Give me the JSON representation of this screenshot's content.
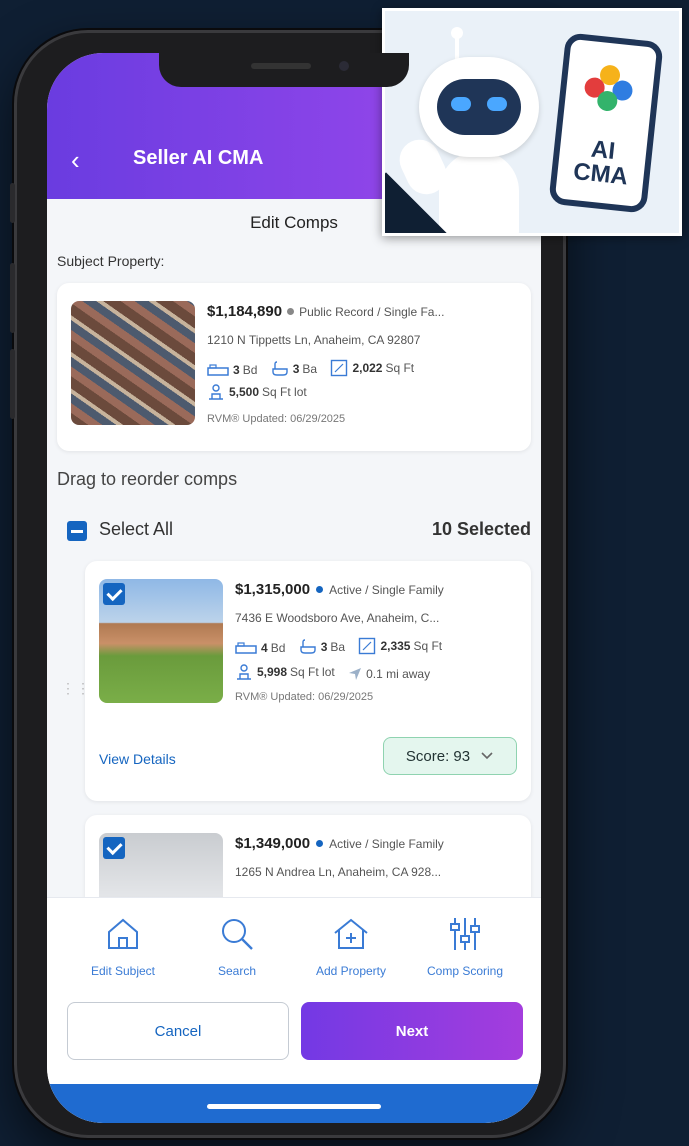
{
  "header": {
    "back_glyph": "‹",
    "title": "Seller AI CMA"
  },
  "sheet": {
    "title": "Edit Comps",
    "subject_label": "Subject Property:"
  },
  "subject": {
    "price": "$1,184,890",
    "status": "Public Record / Single Fa...",
    "address": "1210 N Tippetts Ln, Anaheim, CA 92807",
    "beds": "3",
    "beds_unit": "Bd",
    "baths": "3",
    "baths_unit": "Ba",
    "sqft": "2,022",
    "sqft_unit": "Sq Ft",
    "lot": "5,500",
    "lot_unit": "Sq Ft lot",
    "updated": "RVM® Updated: 06/29/2025"
  },
  "reorder_label": "Drag to reorder comps",
  "select_all_label": "Select All",
  "selected_count": "10 Selected",
  "comps": [
    {
      "price": "$1,315,000",
      "status": "Active / Single Family",
      "address": "7436 E Woodsboro Ave, Anaheim, C...",
      "beds": "4",
      "beds_unit": "Bd",
      "baths": "3",
      "baths_unit": "Ba",
      "sqft": "2,335",
      "sqft_unit": "Sq Ft",
      "lot": "5,998",
      "lot_unit": "Sq Ft lot",
      "distance": "0.1 mi away",
      "updated": "RVM® Updated: 06/29/2025",
      "view_details": "View Details",
      "score": "Score: 93"
    },
    {
      "price": "$1,349,000",
      "status": "Active / Single Family",
      "address": "1265 N Andrea Ln, Anaheim, CA 928..."
    }
  ],
  "bottom_nav": [
    {
      "label": "Edit Subject",
      "icon": "home-icon"
    },
    {
      "label": "Search",
      "icon": "search-icon"
    },
    {
      "label": "Add Property",
      "icon": "add-home-icon"
    },
    {
      "label": "Comp Scoring",
      "icon": "sliders-icon"
    }
  ],
  "actions": {
    "cancel": "Cancel",
    "next": "Next"
  },
  "badge": {
    "line1": "AI",
    "line2": "CMA"
  },
  "colors": {
    "accent_purple": "#7a3fe4",
    "primary_blue": "#1565c0",
    "score_green": "#e4f6ee",
    "background": "#0f1f33"
  }
}
